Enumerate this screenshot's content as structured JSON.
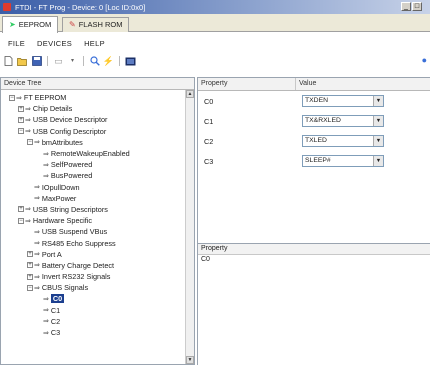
{
  "window": {
    "title": "FTDI - FT Prog - Device: 0 [Loc ID:0x0]",
    "buttons": [
      "_",
      "□"
    ]
  },
  "tabs": [
    {
      "label": "EEPROM",
      "active": true
    },
    {
      "label": "FLASH ROM",
      "active": false
    }
  ],
  "menu": {
    "file": "FILE",
    "devices": "DEVICES",
    "help": "HELP"
  },
  "toolbar": {
    "new_icon": "new-file-icon",
    "open_icon": "open-folder-icon",
    "save_icon": "save-icon",
    "search_icon": "search-icon",
    "program_icon": "program-icon",
    "info_icon": "info-icon"
  },
  "device_tree": {
    "header": "Device Tree",
    "items": [
      {
        "label": "FT EEPROM",
        "toggle": "−",
        "indent": 0
      },
      {
        "label": "Chip Details",
        "toggle": "+",
        "indent": 1
      },
      {
        "label": "USB Device Descriptor",
        "toggle": "+",
        "indent": 1
      },
      {
        "label": "USB Config Descriptor",
        "toggle": "−",
        "indent": 1
      },
      {
        "label": "bmAttributes",
        "toggle": "−",
        "indent": 2
      },
      {
        "label": "RemoteWakeupEnabled",
        "toggle": "",
        "indent": 3
      },
      {
        "label": "SelfPowered",
        "toggle": "",
        "indent": 3
      },
      {
        "label": "BusPowered",
        "toggle": "",
        "indent": 3
      },
      {
        "label": "IOpullDown",
        "toggle": "",
        "indent": 2
      },
      {
        "label": "MaxPower",
        "toggle": "",
        "indent": 2
      },
      {
        "label": "USB String Descriptors",
        "toggle": "+",
        "indent": 1
      },
      {
        "label": "Hardware Specific",
        "toggle": "−",
        "indent": 1
      },
      {
        "label": "USB Suspend VBus",
        "toggle": "",
        "indent": 2
      },
      {
        "label": "RS485 Echo Suppress",
        "toggle": "",
        "indent": 2
      },
      {
        "label": "Port A",
        "toggle": "+",
        "indent": 2
      },
      {
        "label": "Battery Charge Detect",
        "toggle": "+",
        "indent": 2
      },
      {
        "label": "Invert RS232 Signals",
        "toggle": "+",
        "indent": 2
      },
      {
        "label": "CBUS Signals",
        "toggle": "−",
        "indent": 2
      },
      {
        "label": "C0",
        "toggle": "",
        "indent": 3,
        "selected": true
      },
      {
        "label": "C1",
        "toggle": "",
        "indent": 3
      },
      {
        "label": "C2",
        "toggle": "",
        "indent": 3
      },
      {
        "label": "C3",
        "toggle": "",
        "indent": 3
      }
    ]
  },
  "property_grid": {
    "header_property": "Property",
    "header_value": "Value",
    "rows": [
      {
        "property": "C0",
        "value": "TXDEN"
      },
      {
        "property": "C1",
        "value": "TX&RXLED"
      },
      {
        "property": "C2",
        "value": "TXLED"
      },
      {
        "property": "C3",
        "value": "SLEEP#"
      }
    ]
  },
  "description": {
    "header": "Property",
    "text": "C0"
  }
}
